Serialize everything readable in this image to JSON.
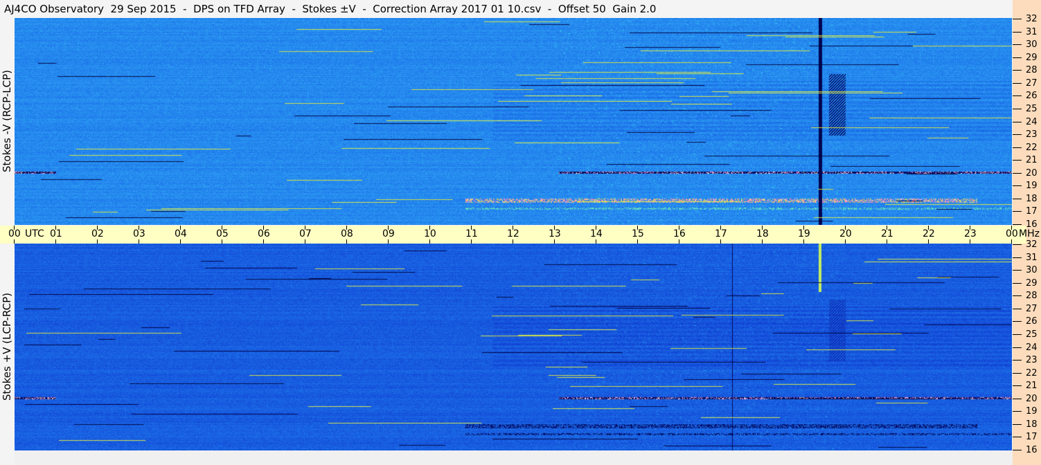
{
  "title": "AJ4CO Observatory  29 Sep 2015  -  DPS on TFD Array  -  Stokes ±V  -  Correction Array 2017 01 10.csv  -  Offset 50  Gain 2.0",
  "chart_data": {
    "type": "heatmap",
    "title": "AJ4CO Observatory  29 Sep 2015  -  DPS on TFD Array  -  Stokes ±V  -  Correction Array 2017 01 10.csv  -  Offset 50  Gain 2.0",
    "xlabel": "UTC",
    "ylabel_unit": "MHz",
    "x_range_hours": [
      0,
      24
    ],
    "y_range_mhz": [
      16,
      32
    ],
    "x_ticks": [
      "00",
      "01",
      "02",
      "03",
      "04",
      "05",
      "06",
      "07",
      "08",
      "09",
      "10",
      "11",
      "12",
      "13",
      "14",
      "15",
      "16",
      "17",
      "18",
      "19",
      "20",
      "21",
      "22",
      "23",
      "00"
    ],
    "y_ticks": [
      "16",
      "17",
      "18",
      "19",
      "20",
      "21",
      "22",
      "23",
      "24",
      "25",
      "26",
      "27",
      "28",
      "29",
      "30",
      "31",
      "32"
    ],
    "panels": [
      {
        "name": "Stokes -V (RCP-LCP)",
        "label": "Stokes -V (RCP-LCP)"
      },
      {
        "name": "Stokes +V (LCP-RCP)",
        "label": "Stokes +V (LCP-RCP)"
      }
    ],
    "utc_label": "UTC",
    "mhz_label": "MHz"
  }
}
